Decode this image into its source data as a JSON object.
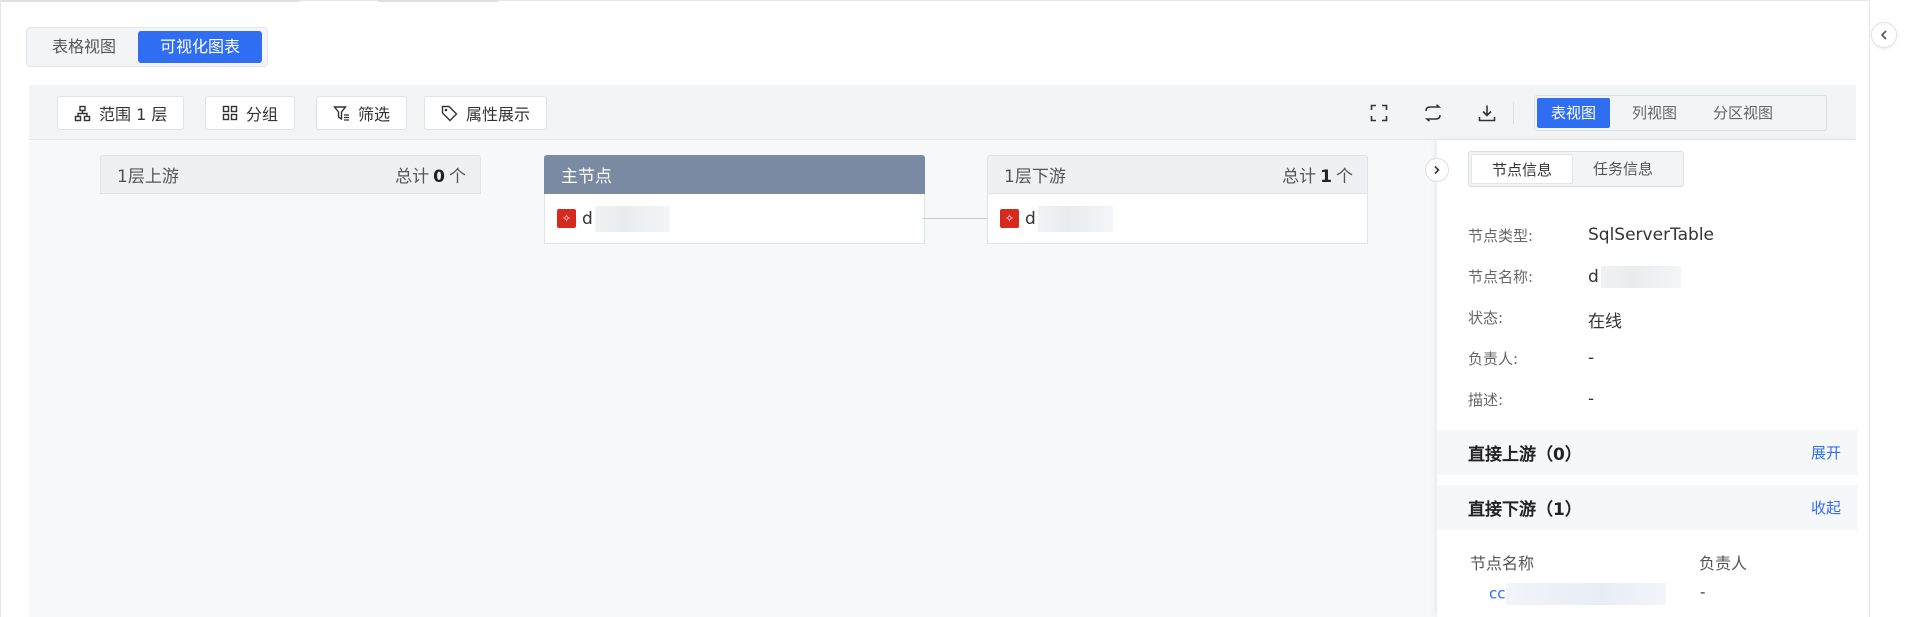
{
  "view_switch": {
    "options": [
      "表格视图",
      "可视化图表"
    ],
    "active": "可视化图表"
  },
  "toolbar": {
    "range_label": "范围 1 层",
    "group_label": "分组",
    "filter_label": "筛选",
    "attr_label": "属性展示",
    "layout_options": [
      "表视图",
      "列视图",
      "分区视图"
    ],
    "layout_active": "表视图"
  },
  "graph": {
    "upstream": {
      "title": "1层上游",
      "total_prefix": "总计",
      "total": "0",
      "total_suffix": "个"
    },
    "main": {
      "title": "主节点",
      "node_name": "d"
    },
    "downstream": {
      "title": "1层下游",
      "total_prefix": "总计",
      "total": "1",
      "total_suffix": "个",
      "node_name": "d"
    }
  },
  "detail": {
    "tabs": [
      "节点信息",
      "任务信息"
    ],
    "active_tab": "节点信息",
    "fields": [
      {
        "key": "节点类型:",
        "value": "SqlServerTable"
      },
      {
        "key": "节点名称:",
        "value": "d"
      },
      {
        "key": "状态:",
        "value": "在线"
      },
      {
        "key": "负责人:",
        "value": "-"
      },
      {
        "key": "描述:",
        "value": "-"
      }
    ],
    "upstream_section": {
      "title": "直接上游（0）",
      "action": "展开"
    },
    "downstream_section": {
      "title": "直接下游（1）",
      "action": "收起"
    },
    "table": {
      "headers": [
        "节点名称",
        "负责人"
      ],
      "rows": [
        {
          "name": "cc",
          "owner": "-"
        }
      ]
    }
  },
  "colors": {
    "accent": "#2f6df2",
    "main_node_header": "#7a8aa2",
    "node_icon": "#d72a1e"
  }
}
